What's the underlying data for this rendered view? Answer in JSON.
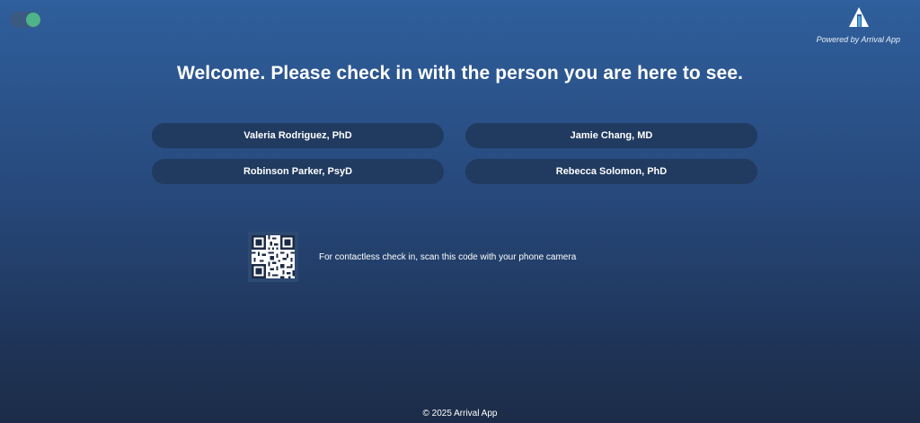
{
  "header": {
    "brand_text": "Powered by Arrival App"
  },
  "main": {
    "headline": "Welcome.  Please check in with the person you are here to see.",
    "people": [
      {
        "label": "Valeria Rodriguez, PhD"
      },
      {
        "label": "Jamie Chang, MD"
      },
      {
        "label": "Robinson Parker, PsyD"
      },
      {
        "label": "Rebecca Solomon, PhD"
      }
    ],
    "qr_instruction": "For contactless check in, scan this code with your phone camera"
  },
  "footer": {
    "copyright": "© 2025 Arrival App"
  },
  "colors": {
    "toggle_on": "#4fb38a",
    "button_bg": "#213a5f"
  },
  "icons": {
    "toggle": "toggle-switch",
    "logo": "arrival-app-logo-icon",
    "qr": "qr-code-icon"
  }
}
